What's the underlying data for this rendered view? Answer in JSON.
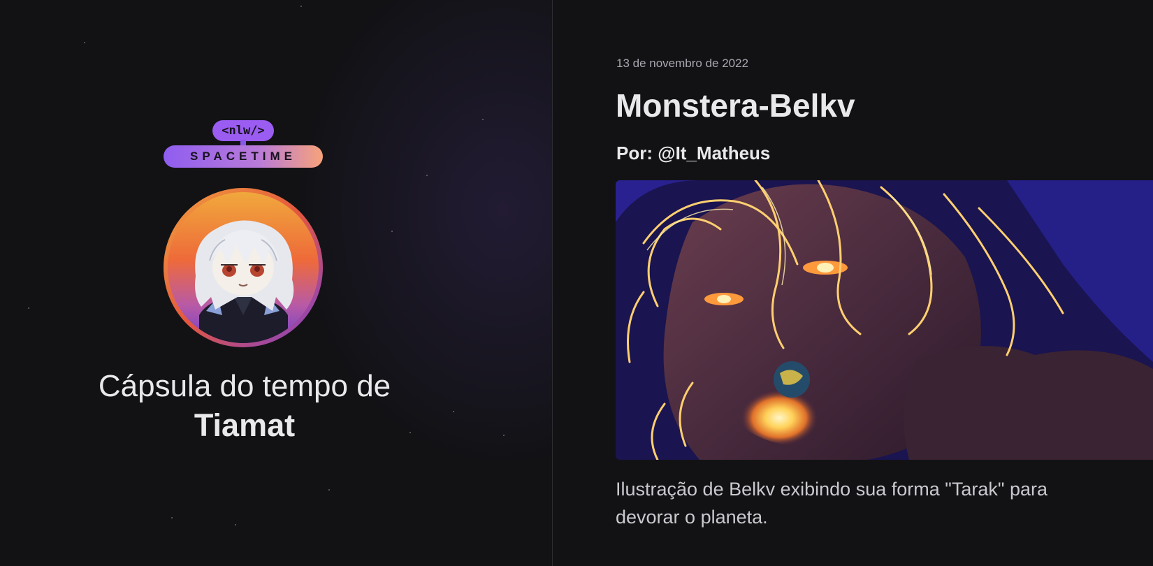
{
  "brand": {
    "logo_top": "<nlw/>",
    "logo_bottom": "SPACETIME"
  },
  "profile": {
    "avatar_icon": "anime-character-avatar",
    "heading_prefix": "Cápsula do tempo de",
    "name": "Tiamat"
  },
  "memory": {
    "date": "13 de novembro de 2022",
    "title": "Monstera-Belkv",
    "author": "Por: @It_Matheus",
    "image_icon": "illustration-image",
    "description": "Ilustração de Belkv exibindo sua forma \"Tarak\" para devorar o planeta."
  },
  "colors": {
    "background": "#121215",
    "accent_purple": "#9b5cf2",
    "accent_orange": "#f7a27a",
    "text_primary": "#e9e9ec"
  }
}
